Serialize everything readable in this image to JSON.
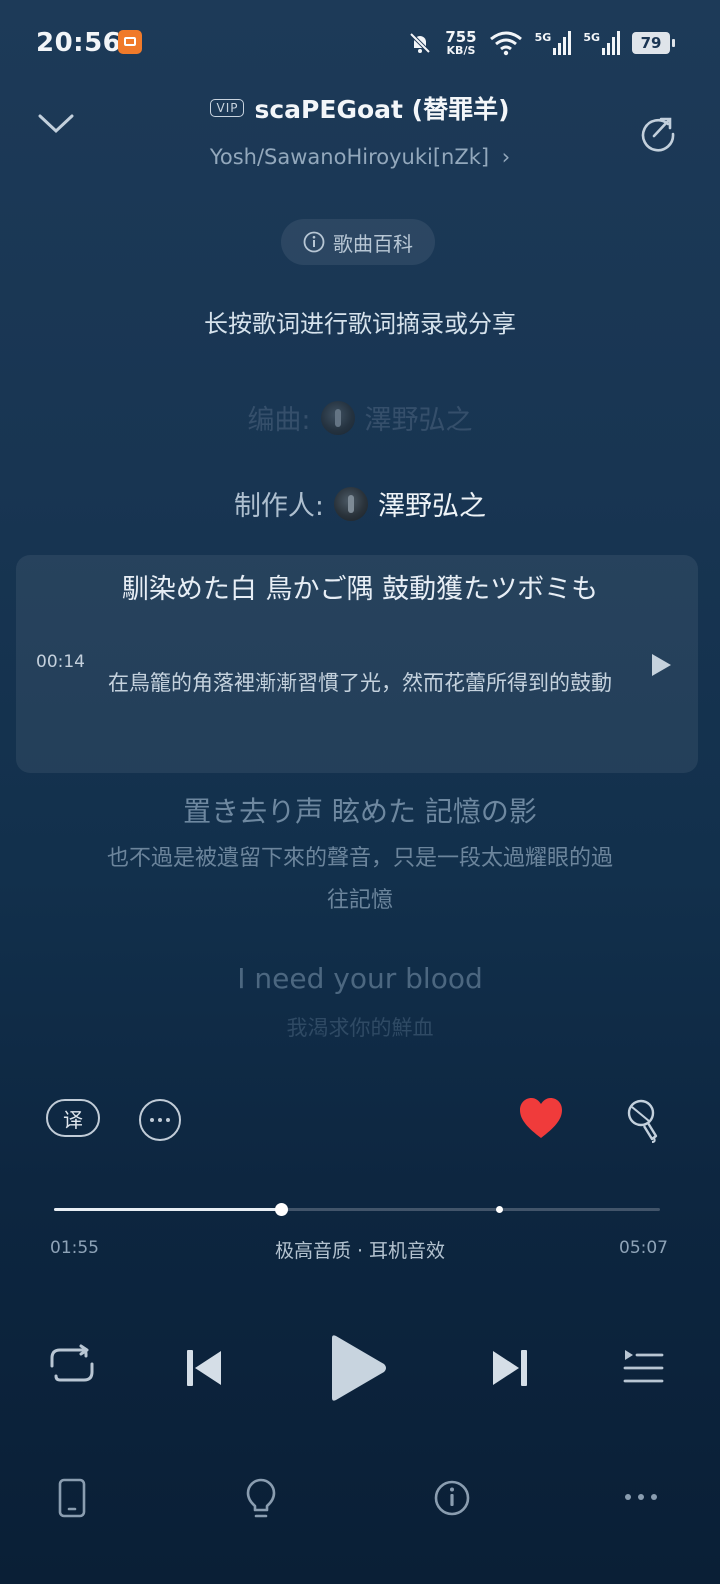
{
  "status_bar": {
    "time": "20:56",
    "net_speed_value": "755",
    "net_speed_unit": "KB/S",
    "signal1": "5G",
    "signal2": "5G",
    "battery": "79"
  },
  "header": {
    "vip_badge": "VIP",
    "song_title": "scaPEGoat (替罪羊)",
    "artist": "Yosh/SawanoHiroyuki[nZk]",
    "artist_chevron": "›"
  },
  "baike_label": "歌曲百科",
  "hint_text": "长按歌词进行歌词摘录或分享",
  "credits": [
    {
      "label": "编曲:",
      "name": "澤野弘之"
    },
    {
      "label": "制作人:",
      "name": "澤野弘之"
    }
  ],
  "current_lyric": {
    "timestamp": "00:14",
    "original": "馴染めた白 鳥かご隅 鼓動獲たツボミも",
    "translation": "在鳥籠的角落裡漸漸習慣了光，然而花蕾所得到的鼓動"
  },
  "next_lyrics": [
    {
      "original": "置き去り声 眩めた 記憶の影",
      "translation": "也不過是被遺留下來的聲音，只是一段太過耀眼的過往記憶"
    },
    {
      "original": "I need your blood",
      "translation": "我渴求你的鮮血"
    }
  ],
  "actions": {
    "translate_label": "译",
    "liked": true,
    "heart_color": "#f03b3b"
  },
  "progress": {
    "current": "01:55",
    "total": "05:07",
    "fraction": 0.375,
    "quality_label": "极高音质 · 耳机音效"
  },
  "controls": [
    "repeat-icon",
    "previous-icon",
    "play-icon",
    "next-icon",
    "playlist-icon"
  ],
  "bottom_bar": [
    "phone-device-icon",
    "lightbulb-icon",
    "info-icon",
    "more-horizontal-icon"
  ]
}
